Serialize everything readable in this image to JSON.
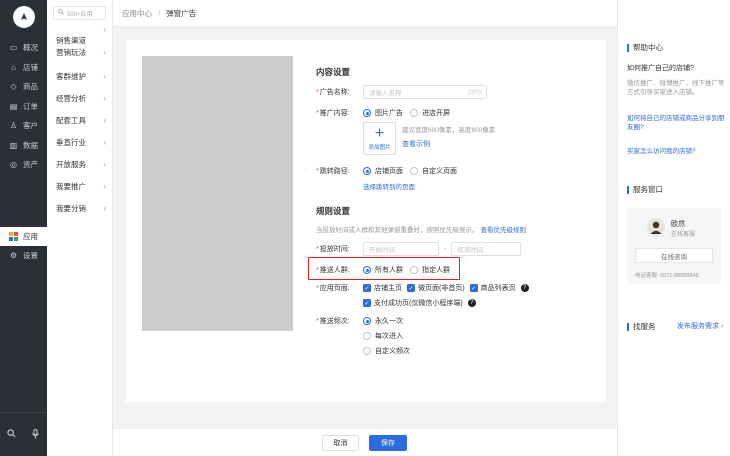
{
  "nav": {
    "items": [
      {
        "label": "概况",
        "icon": "monitor-icon"
      },
      {
        "label": "店铺",
        "icon": "store-icon"
      },
      {
        "label": "商品",
        "icon": "tag-icon"
      },
      {
        "label": "订单",
        "icon": "document-icon"
      },
      {
        "label": "客户",
        "icon": "user-icon"
      },
      {
        "label": "数据",
        "icon": "bar-chart-icon"
      },
      {
        "label": "资产",
        "icon": "asset-icon"
      }
    ],
    "app_label": "应用",
    "settings_label": "设置"
  },
  "submenu": {
    "search_placeholder": "500+应用",
    "items": [
      "销售渠道",
      "营销玩法",
      "客群维护",
      "经营分析",
      "配套工具",
      "垂直行业",
      "开放服务",
      "我要推广",
      "我要分销"
    ]
  },
  "header": {
    "crumb1": "应用中心",
    "sep": "/",
    "crumb2": "弹窗广告"
  },
  "form": {
    "content_title": "内容设置",
    "ad_name_label": "广告名称:",
    "ad_name_placeholder": "请输入名称",
    "ad_name_count": "(0/0)",
    "promo_label": "推广内容:",
    "promo_opt1": "图片广告",
    "promo_opt2": "进店开屏",
    "upload_label": "添加图片",
    "upload_hint": "建议宽度600像素，高度800像素",
    "view_example": "查看示例",
    "jump_label": "跳转路径:",
    "jump_opt1": "店铺页面",
    "jump_opt2": "自定义页面",
    "jump_select": "选择跳转到的页面",
    "rules_title": "规则设置",
    "rules_hint": "当投放时间或人群和其他弹窗重叠时，按照优先级展示。",
    "rules_link": "查看优先级规则",
    "time_label": "投放时间:",
    "time_start": "开始时间",
    "time_sep": "-",
    "time_end": "结束时间",
    "audience_label": "推送人群:",
    "audience_opt1": "所有人群",
    "audience_opt2": "指定人群",
    "pages_label": "应用页面:",
    "page1": "店铺主页",
    "page2": "微页面(非首页)",
    "page3": "商品列表页",
    "page4": "支付成功页(仅微信小程序端)",
    "freq_label": "推送频次:",
    "freq_opt1": "永久一次",
    "freq_opt2": "每次进入",
    "freq_opt3": "自定义频次"
  },
  "footer": {
    "cancel": "取消",
    "save": "保存"
  },
  "help": {
    "title": "帮助中心",
    "q1": "如何推广自己的店铺?",
    "a1": "微信推广、微博推广、线下推广等方式引导买家进入店铺。",
    "link1": "如何将自己的店铺或商品分享到朋友圈?",
    "link2": "买家怎么访问我的店铺?",
    "service_title": "服务窗口",
    "agent_name": "欧然",
    "agent_status": "在线客服",
    "consult_btn": "在线咨询",
    "phone": "电话客服: 0571-88888848",
    "find_title": "找服务",
    "publish_link": "发布服务需求"
  },
  "colors": {
    "accent": "#2d6cdf",
    "nav_bg": "#2b2f36",
    "highlight": "#e02020"
  }
}
